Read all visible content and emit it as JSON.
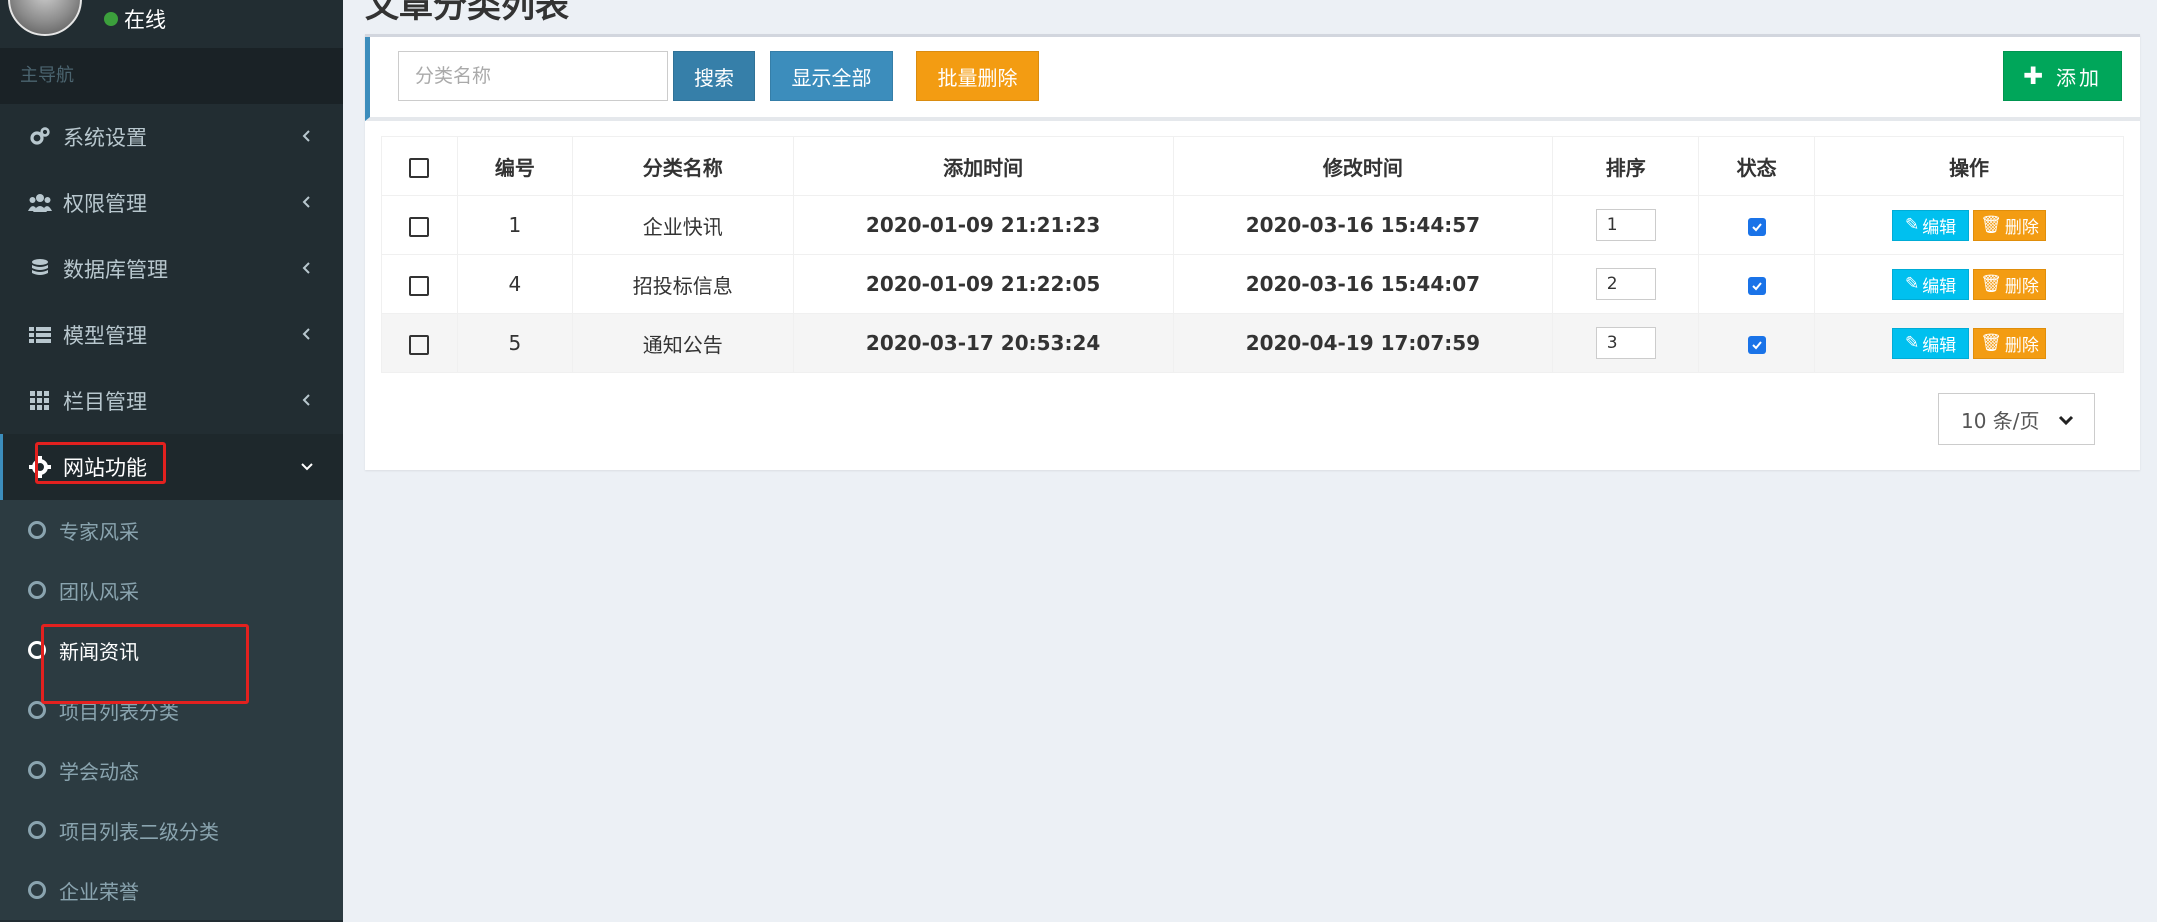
{
  "user": {
    "status": "在线"
  },
  "sidebar": {
    "header": "主导航",
    "items": [
      {
        "label": "系统设置",
        "icon": "gears-icon"
      },
      {
        "label": "权限管理",
        "icon": "users-icon"
      },
      {
        "label": "数据库管理",
        "icon": "database-icon"
      },
      {
        "label": "模型管理",
        "icon": "list-icon"
      },
      {
        "label": "栏目管理",
        "icon": "grid-icon"
      },
      {
        "label": "网站功能",
        "icon": "gear-icon",
        "expanded": true
      }
    ],
    "submenu": [
      {
        "label": "专家风采"
      },
      {
        "label": "团队风采"
      },
      {
        "label": "新闻资讯",
        "active": true
      },
      {
        "label": "项目列表分类"
      },
      {
        "label": "学会动态"
      },
      {
        "label": "项目列表二级分类"
      },
      {
        "label": "企业荣誉"
      }
    ]
  },
  "page": {
    "title": "文章分类列表"
  },
  "toolbar": {
    "search_placeholder": "分类名称",
    "search_label": "搜索",
    "show_all_label": "显示全部",
    "batch_delete_label": "批量删除",
    "add_label": "添加"
  },
  "table": {
    "headers": [
      "编号",
      "分类名称",
      "添加时间",
      "修改时间",
      "排序",
      "状态",
      "操作"
    ],
    "rows": [
      {
        "id": "1",
        "name": "企业快讯",
        "created": "2020-01-09 21:21:23",
        "modified": "2020-03-16 15:44:57",
        "sort": "1",
        "status": true
      },
      {
        "id": "4",
        "name": "招投标信息",
        "created": "2020-01-09 21:22:05",
        "modified": "2020-03-16 15:44:07",
        "sort": "2",
        "status": true
      },
      {
        "id": "5",
        "name": "通知公告",
        "created": "2020-03-17 20:53:24",
        "modified": "2020-04-19 17:07:59",
        "sort": "3",
        "status": true
      }
    ],
    "edit_label": "编辑",
    "delete_label": "删除"
  },
  "pagination": {
    "page_size": "10 条/页"
  },
  "colors": {
    "sidebar_bg": "#222d32",
    "primary": "#3c8dbc",
    "warning": "#f39c12",
    "success": "#00a65a",
    "info": "#00c0ef",
    "highlight": "#e3211f"
  }
}
